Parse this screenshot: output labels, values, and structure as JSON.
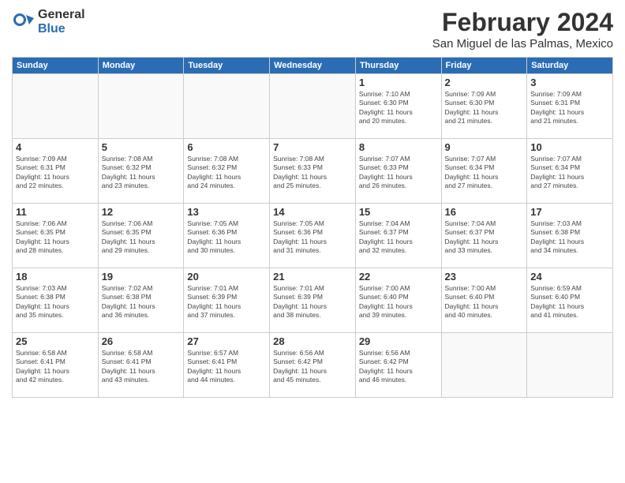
{
  "logo": {
    "general": "General",
    "blue": "Blue"
  },
  "header": {
    "month_year": "February 2024",
    "location": "San Miguel de las Palmas, Mexico"
  },
  "days_of_week": [
    "Sunday",
    "Monday",
    "Tuesday",
    "Wednesday",
    "Thursday",
    "Friday",
    "Saturday"
  ],
  "weeks": [
    [
      {
        "day": "",
        "info": ""
      },
      {
        "day": "",
        "info": ""
      },
      {
        "day": "",
        "info": ""
      },
      {
        "day": "",
        "info": ""
      },
      {
        "day": "1",
        "info": "Sunrise: 7:10 AM\nSunset: 6:30 PM\nDaylight: 11 hours\nand 20 minutes."
      },
      {
        "day": "2",
        "info": "Sunrise: 7:09 AM\nSunset: 6:30 PM\nDaylight: 11 hours\nand 21 minutes."
      },
      {
        "day": "3",
        "info": "Sunrise: 7:09 AM\nSunset: 6:31 PM\nDaylight: 11 hours\nand 21 minutes."
      }
    ],
    [
      {
        "day": "4",
        "info": "Sunrise: 7:09 AM\nSunset: 6:31 PM\nDaylight: 11 hours\nand 22 minutes."
      },
      {
        "day": "5",
        "info": "Sunrise: 7:08 AM\nSunset: 6:32 PM\nDaylight: 11 hours\nand 23 minutes."
      },
      {
        "day": "6",
        "info": "Sunrise: 7:08 AM\nSunset: 6:32 PM\nDaylight: 11 hours\nand 24 minutes."
      },
      {
        "day": "7",
        "info": "Sunrise: 7:08 AM\nSunset: 6:33 PM\nDaylight: 11 hours\nand 25 minutes."
      },
      {
        "day": "8",
        "info": "Sunrise: 7:07 AM\nSunset: 6:33 PM\nDaylight: 11 hours\nand 26 minutes."
      },
      {
        "day": "9",
        "info": "Sunrise: 7:07 AM\nSunset: 6:34 PM\nDaylight: 11 hours\nand 27 minutes."
      },
      {
        "day": "10",
        "info": "Sunrise: 7:07 AM\nSunset: 6:34 PM\nDaylight: 11 hours\nand 27 minutes."
      }
    ],
    [
      {
        "day": "11",
        "info": "Sunrise: 7:06 AM\nSunset: 6:35 PM\nDaylight: 11 hours\nand 28 minutes."
      },
      {
        "day": "12",
        "info": "Sunrise: 7:06 AM\nSunset: 6:35 PM\nDaylight: 11 hours\nand 29 minutes."
      },
      {
        "day": "13",
        "info": "Sunrise: 7:05 AM\nSunset: 6:36 PM\nDaylight: 11 hours\nand 30 minutes."
      },
      {
        "day": "14",
        "info": "Sunrise: 7:05 AM\nSunset: 6:36 PM\nDaylight: 11 hours\nand 31 minutes."
      },
      {
        "day": "15",
        "info": "Sunrise: 7:04 AM\nSunset: 6:37 PM\nDaylight: 11 hours\nand 32 minutes."
      },
      {
        "day": "16",
        "info": "Sunrise: 7:04 AM\nSunset: 6:37 PM\nDaylight: 11 hours\nand 33 minutes."
      },
      {
        "day": "17",
        "info": "Sunrise: 7:03 AM\nSunset: 6:38 PM\nDaylight: 11 hours\nand 34 minutes."
      }
    ],
    [
      {
        "day": "18",
        "info": "Sunrise: 7:03 AM\nSunset: 6:38 PM\nDaylight: 11 hours\nand 35 minutes."
      },
      {
        "day": "19",
        "info": "Sunrise: 7:02 AM\nSunset: 6:38 PM\nDaylight: 11 hours\nand 36 minutes."
      },
      {
        "day": "20",
        "info": "Sunrise: 7:01 AM\nSunset: 6:39 PM\nDaylight: 11 hours\nand 37 minutes."
      },
      {
        "day": "21",
        "info": "Sunrise: 7:01 AM\nSunset: 6:39 PM\nDaylight: 11 hours\nand 38 minutes."
      },
      {
        "day": "22",
        "info": "Sunrise: 7:00 AM\nSunset: 6:40 PM\nDaylight: 11 hours\nand 39 minutes."
      },
      {
        "day": "23",
        "info": "Sunrise: 7:00 AM\nSunset: 6:40 PM\nDaylight: 11 hours\nand 40 minutes."
      },
      {
        "day": "24",
        "info": "Sunrise: 6:59 AM\nSunset: 6:40 PM\nDaylight: 11 hours\nand 41 minutes."
      }
    ],
    [
      {
        "day": "25",
        "info": "Sunrise: 6:58 AM\nSunset: 6:41 PM\nDaylight: 11 hours\nand 42 minutes."
      },
      {
        "day": "26",
        "info": "Sunrise: 6:58 AM\nSunset: 6:41 PM\nDaylight: 11 hours\nand 43 minutes."
      },
      {
        "day": "27",
        "info": "Sunrise: 6:57 AM\nSunset: 6:41 PM\nDaylight: 11 hours\nand 44 minutes."
      },
      {
        "day": "28",
        "info": "Sunrise: 6:56 AM\nSunset: 6:42 PM\nDaylight: 11 hours\nand 45 minutes."
      },
      {
        "day": "29",
        "info": "Sunrise: 6:56 AM\nSunset: 6:42 PM\nDaylight: 11 hours\nand 46 minutes."
      },
      {
        "day": "",
        "info": ""
      },
      {
        "day": "",
        "info": ""
      }
    ]
  ]
}
